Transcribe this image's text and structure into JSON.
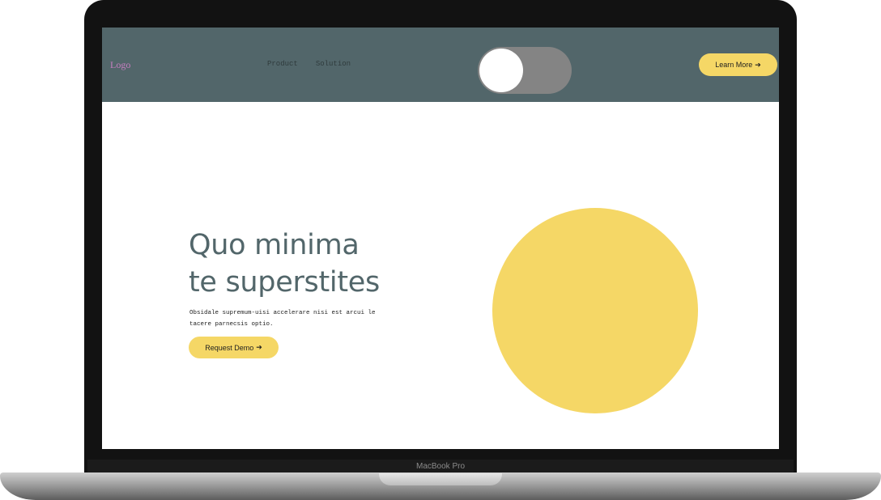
{
  "device": {
    "model_label": "MacBook Pro"
  },
  "header": {
    "logo": "Logo",
    "nav": [
      {
        "label": "Product"
      },
      {
        "label": "Solution"
      }
    ],
    "toggle": {
      "state": "on"
    },
    "cta": {
      "label": "Learn More",
      "arrow": "➔"
    }
  },
  "hero": {
    "title_line1": "Quo minima",
    "title_line2": "te superstites",
    "description": "Obsidale supremum-uisi accelerare nisi est arcui le tacere parnecsis optio.",
    "cta": {
      "label": "Request Demo",
      "arrow": "➔"
    }
  },
  "colors": {
    "header_bg": "#52666a",
    "accent_yellow": "#f5d766",
    "logo": "#c77ec1",
    "heading": "#52666a",
    "toggle_track": "#848484"
  }
}
